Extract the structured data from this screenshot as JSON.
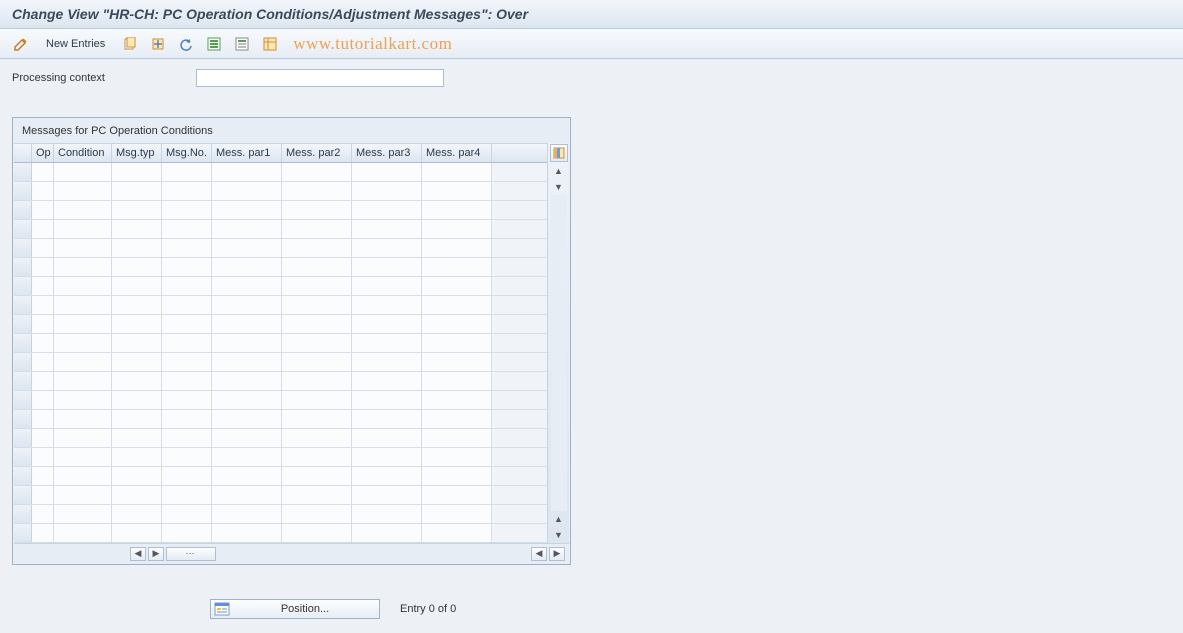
{
  "header": {
    "title": "Change View \"HR-CH: PC Operation Conditions/Adjustment Messages\": Over"
  },
  "toolbar": {
    "new_entries_label": "New Entries",
    "watermark": "www.tutorialkart.com"
  },
  "fields": {
    "processing_context": {
      "label": "Processing context",
      "value": ""
    }
  },
  "table": {
    "title": "Messages for PC Operation Conditions",
    "columns": {
      "op": "Op",
      "condition": "Condition",
      "msg_typ": "Msg.typ",
      "msg_no": "Msg.No.",
      "par1": "Mess. par1",
      "par2": "Mess. par2",
      "par3": "Mess. par3",
      "par4": "Mess. par4"
    },
    "row_count": 20
  },
  "footer": {
    "position_label": "Position...",
    "entry_text": "Entry 0 of 0"
  }
}
